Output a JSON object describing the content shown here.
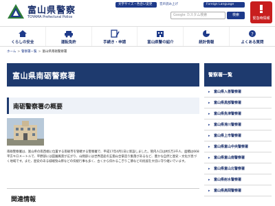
{
  "header": {
    "title": "富山県警察",
    "subtitle": "TOYAMA Prefectural Police",
    "util_size": "文字サイズ・色合い変更",
    "util_voice": "音声読み上げ",
    "util_lang": "Foreign Language",
    "search_placeholder": "Google カスタム検索",
    "search_button": "検索",
    "emergency_label": "緊急時情報"
  },
  "nav": {
    "items": [
      {
        "label": "くらしの安全"
      },
      {
        "label": "運転免許"
      },
      {
        "label": "手続き・申請"
      },
      {
        "label": "富山県警の紹介"
      },
      {
        "label": "統計情報"
      },
      {
        "label": "よくある質問"
      }
    ]
  },
  "breadcrumb": {
    "home": "ホーム",
    "level1": "警察署一覧",
    "current": "富山県南砺警察署"
  },
  "main": {
    "page_title": "富山県南砺警察署",
    "section_title": "南砺警察署の概要",
    "description": "南砺警察署は、富山県の南西端に位置する南砺市を管轄する警察署で、平成17年4月1日に新設しました。管内人口は約5万3千人、面積は668平方キロメートルで、平野部には田園風景が広がり、山間部には世界遺産の五箇山合掌造り集落があるなど、豊かな自然と歴史・文化が息づく地域です。また、歴史のある城端曳山祭などの伝統行事も多く、古くから伝わるこぎりこ節などの民謡を大切に守り継いでいます。",
    "related_title": "関連情報"
  },
  "sidebar": {
    "title": "警察署一覧",
    "items": [
      {
        "label": "富山県入善警察署"
      },
      {
        "label": "富山県黒部警察署"
      },
      {
        "label": "富山県魚津警察署"
      },
      {
        "label": "富山県滑川警察署"
      },
      {
        "label": "富山県上市警察署"
      },
      {
        "label": "富山県富山中央警察署"
      },
      {
        "label": "富山県富山南警察署"
      },
      {
        "label": "富山県富山北警察署"
      },
      {
        "label": "富山県射水警察署"
      },
      {
        "label": "富山県高岡警察署"
      }
    ]
  },
  "colors": {
    "navy": "#1e3a6e",
    "link_blue": "#1e3a8a",
    "emergency_red": "#c81e1e"
  }
}
